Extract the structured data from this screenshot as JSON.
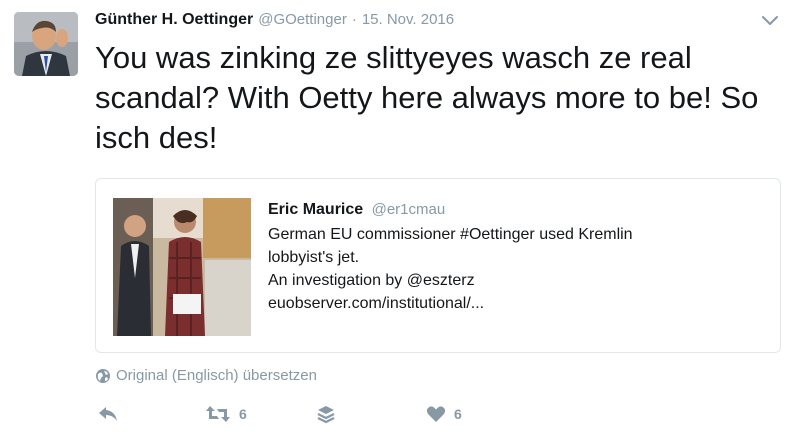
{
  "tweet": {
    "author_name": "Günther H. Oettinger",
    "author_handle": "@GOettinger",
    "separator": "·",
    "date": "15. Nov. 2016",
    "text": "You was zinking ze slittyeyes wasch ze real scandal? With Oetty here always more to be! So isch des!"
  },
  "quoted_tweet": {
    "author_name": "Eric Maurice",
    "author_handle": "@er1cmau",
    "lines": [
      "German EU commissioner #Oettinger used Kremlin",
      "lobbyist's jet.",
      "An investigation by @eszterz",
      "euobserver.com/institutional/..."
    ]
  },
  "translate": {
    "label": "Original (Englisch) übersetzen",
    "icon": "globe-icon"
  },
  "actions": {
    "reply_icon": "reply-icon",
    "retweet_icon": "retweet-icon",
    "retweet_count": "6",
    "moments_icon": "layers-icon",
    "like_icon": "heart-icon",
    "like_count": "6"
  },
  "colors": {
    "text": "#14171a",
    "muted": "#8899a6",
    "border": "#e1e8ed"
  }
}
